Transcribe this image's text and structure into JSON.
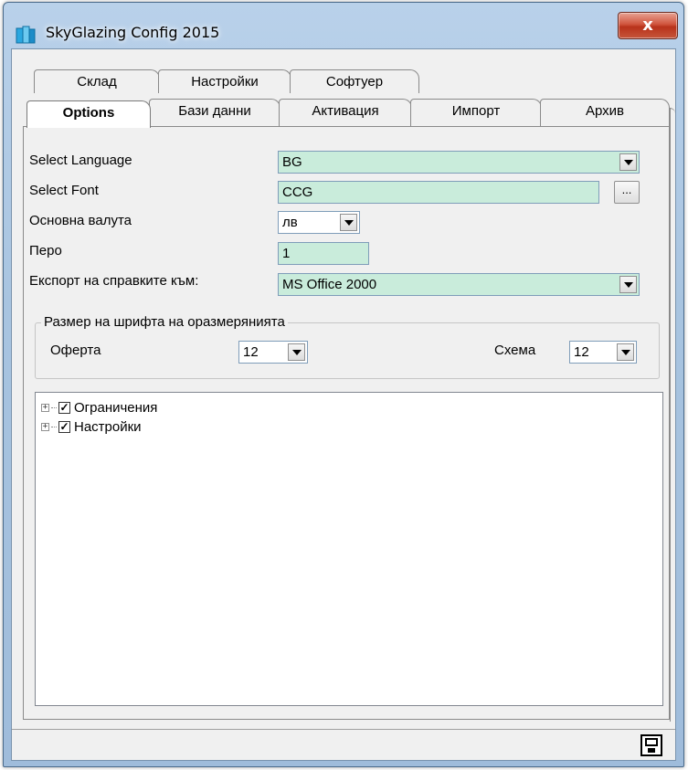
{
  "window": {
    "title": "SkyGlazing Config 2015",
    "close_label": "x"
  },
  "tabs_row1": [
    {
      "label": "Склад"
    },
    {
      "label": "Настройки"
    },
    {
      "label": "Софтуер"
    }
  ],
  "tabs_row2": [
    {
      "label": "Options",
      "active": true
    },
    {
      "label": "Бази данни"
    },
    {
      "label": "Активация"
    },
    {
      "label": "Импорт"
    },
    {
      "label": "Архив"
    }
  ],
  "form": {
    "language": {
      "label": "Select Language",
      "value": "BG"
    },
    "font": {
      "label": "Select Font",
      "value": "CCG",
      "browse_label": "..."
    },
    "currency": {
      "label": "Основна валута",
      "value": "лв"
    },
    "pen": {
      "label": "Перо",
      "value": "1"
    },
    "export": {
      "label": "Експорт на справките към:",
      "value": "MS Office 2000"
    }
  },
  "font_size_group": {
    "legend": "Размер на шрифта на оразмерянията",
    "offer": {
      "label": "Оферта",
      "value": "12"
    },
    "scheme": {
      "label": "Схема",
      "value": "12"
    }
  },
  "tree": [
    {
      "label": "Ограничения",
      "checked": true,
      "expander": "+"
    },
    {
      "label": "Настройки",
      "checked": true,
      "expander": "+"
    }
  ],
  "colors": {
    "field_bg": "#c9ecdb",
    "window_frame": "#a8c4e0",
    "close_button": "#c6553a"
  },
  "icons": {
    "app": "app-icon",
    "save": "floppy-disk-icon"
  }
}
